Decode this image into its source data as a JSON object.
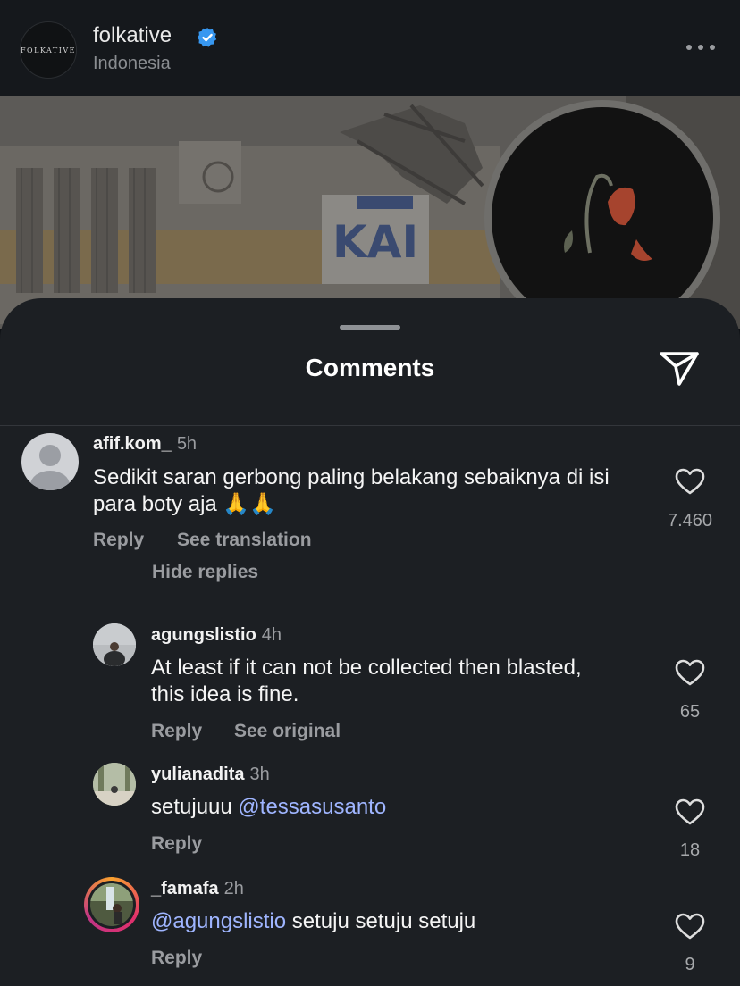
{
  "header": {
    "username": "folkative",
    "avatar_text": "FOLKATIVE",
    "location": "Indonesia",
    "verified_color": "#3797f0"
  },
  "sheet": {
    "title": "Comments",
    "share_icon": "send-icon"
  },
  "comments": [
    {
      "username": "afif.kom_",
      "time": "5h",
      "text": "Sedikit saran gerbong paling belakang sebaiknya di isi para boty aja 🙏🙏",
      "likes": "7.460",
      "reply_label": "Reply",
      "translate_label": "See translation",
      "hide_replies_label": "Hide replies"
    },
    {
      "username": "agungslistio",
      "time": "4h",
      "text": "At least if it can not be collected then blasted, this idea is fine.",
      "likes": "65",
      "reply_label": "Reply",
      "original_label": "See original"
    },
    {
      "username": "yulianadita",
      "time": "3h",
      "text_prefix": "setujuuu ",
      "mention": "@tessasusanto",
      "likes": "18",
      "reply_label": "Reply"
    },
    {
      "username": "_famafa",
      "time": "2h",
      "mention": "@agungslistio",
      "text_suffix": " setuju setuju setuju",
      "likes": "9",
      "reply_label": "Reply"
    }
  ],
  "colors": {
    "mention": "#9fb5ff",
    "story_ring": "#e1306c"
  }
}
